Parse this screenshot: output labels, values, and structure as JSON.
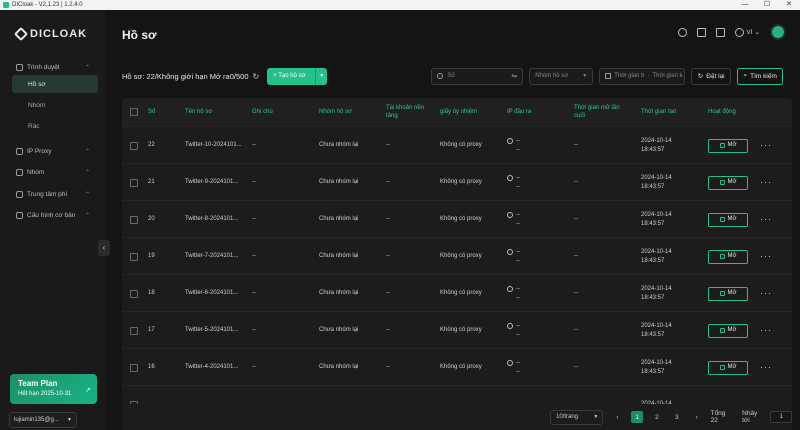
{
  "window": {
    "title": "DICloak - V2.1.23 | 1.2.4.0",
    "min": "—",
    "max": "☐",
    "close": "✕"
  },
  "sidebar": {
    "brand": "DICLOAK",
    "browser_label": "Trình duyệt",
    "sub_items": [
      "Hồ sơ",
      "Nhóm",
      "Rác"
    ],
    "items": [
      {
        "label": "IP Proxy"
      },
      {
        "label": "Nhóm"
      },
      {
        "label": "Trung tâm phí"
      },
      {
        "label": "Cấu hình cơ bản"
      }
    ],
    "plan": {
      "title": "Team Plan",
      "expiry": "Hết hạn 2025-10-31",
      "arrow": "↗"
    },
    "user": "lujiamin135@g..."
  },
  "header": {
    "title": "Hồ sơ",
    "language": "VI"
  },
  "toolbar": {
    "quota": "Hồ sơ:  22/Không giới hạn   Mở ra0/500",
    "create_label": "+ Tạo hồ sơ",
    "search_placeholder": "Số",
    "group_placeholder": "Nhóm hồ sơ",
    "date_start": "Thời gian b",
    "date_sep": "-",
    "date_end": "Thời gian k",
    "reset_label": "Đặt lại",
    "search_label": "Tìm kiếm"
  },
  "table": {
    "headers": [
      "Số",
      "Tên hồ sơ",
      "Ghi chú",
      "Nhóm hồ sơ",
      "Tài khoản nền tảng",
      "giấy ủy nhiệm",
      "IP đầu ra",
      "Thời gian mở lần cuối",
      "Thời gian tạo",
      "Hoạt động"
    ],
    "rows": [
      {
        "no": "22",
        "name": "Twitter-10-2024101...",
        "note": "--",
        "group": "Chưa nhóm lại",
        "platform": "--",
        "proxy": "Không có proxy",
        "ip1": "--",
        "ip2": "--",
        "last_open": "--",
        "created_date": "2024-10-14",
        "created_time": "18:43:57",
        "action": "Mở",
        "more": "···"
      },
      {
        "no": "21",
        "name": "Twitter-9-2024101...",
        "note": "--",
        "group": "Chưa nhóm lại",
        "platform": "--",
        "proxy": "Không có proxy",
        "ip1": "--",
        "ip2": "--",
        "last_open": "--",
        "created_date": "2024-10-14",
        "created_time": "18:43:57",
        "action": "Mở",
        "more": "···"
      },
      {
        "no": "20",
        "name": "Twitter-8-2024101...",
        "note": "--",
        "group": "Chưa nhóm lại",
        "platform": "--",
        "proxy": "Không có proxy",
        "ip1": "--",
        "ip2": "--",
        "last_open": "--",
        "created_date": "2024-10-14",
        "created_time": "18:43:57",
        "action": "Mở",
        "more": "···"
      },
      {
        "no": "19",
        "name": "Twitter-7-2024101...",
        "note": "--",
        "group": "Chưa nhóm lại",
        "platform": "--",
        "proxy": "Không có proxy",
        "ip1": "--",
        "ip2": "--",
        "last_open": "--",
        "created_date": "2024-10-14",
        "created_time": "18:43:57",
        "action": "Mở",
        "more": "···"
      },
      {
        "no": "18",
        "name": "Twitter-6-2024101...",
        "note": "--",
        "group": "Chưa nhóm lại",
        "platform": "--",
        "proxy": "Không có proxy",
        "ip1": "--",
        "ip2": "--",
        "last_open": "--",
        "created_date": "2024-10-14",
        "created_time": "18:43:57",
        "action": "Mở",
        "more": "···"
      },
      {
        "no": "17",
        "name": "Twitter-5-2024101...",
        "note": "--",
        "group": "Chưa nhóm lại",
        "platform": "--",
        "proxy": "Không có proxy",
        "ip1": "--",
        "ip2": "--",
        "last_open": "--",
        "created_date": "2024-10-14",
        "created_time": "18:43:57",
        "action": "Mở",
        "more": "···"
      },
      {
        "no": "16",
        "name": "Twitter-4-2024101...",
        "note": "--",
        "group": "Chưa nhóm lại",
        "platform": "--",
        "proxy": "Không có proxy",
        "ip1": "--",
        "ip2": "--",
        "last_open": "--",
        "created_date": "2024-10-14",
        "created_time": "18:43:57",
        "action": "Mở",
        "more": "···"
      },
      {
        "no": "",
        "name": "",
        "note": "",
        "group": "",
        "platform": "",
        "proxy": "",
        "ip1": "",
        "ip2": "",
        "last_open": "",
        "created_date": "2024-10-14",
        "created_time": "",
        "action": "",
        "more": ""
      }
    ]
  },
  "pagination": {
    "per_page": "10/trang",
    "prev": "‹",
    "pages": [
      "1",
      "2",
      "3"
    ],
    "next": "›",
    "total": "Tổng 22",
    "goto_label": "Nhảy tới",
    "goto_value": "1"
  },
  "colors": {
    "accent": "#24c08d",
    "header_text": "#30c993",
    "background": "#141414"
  }
}
